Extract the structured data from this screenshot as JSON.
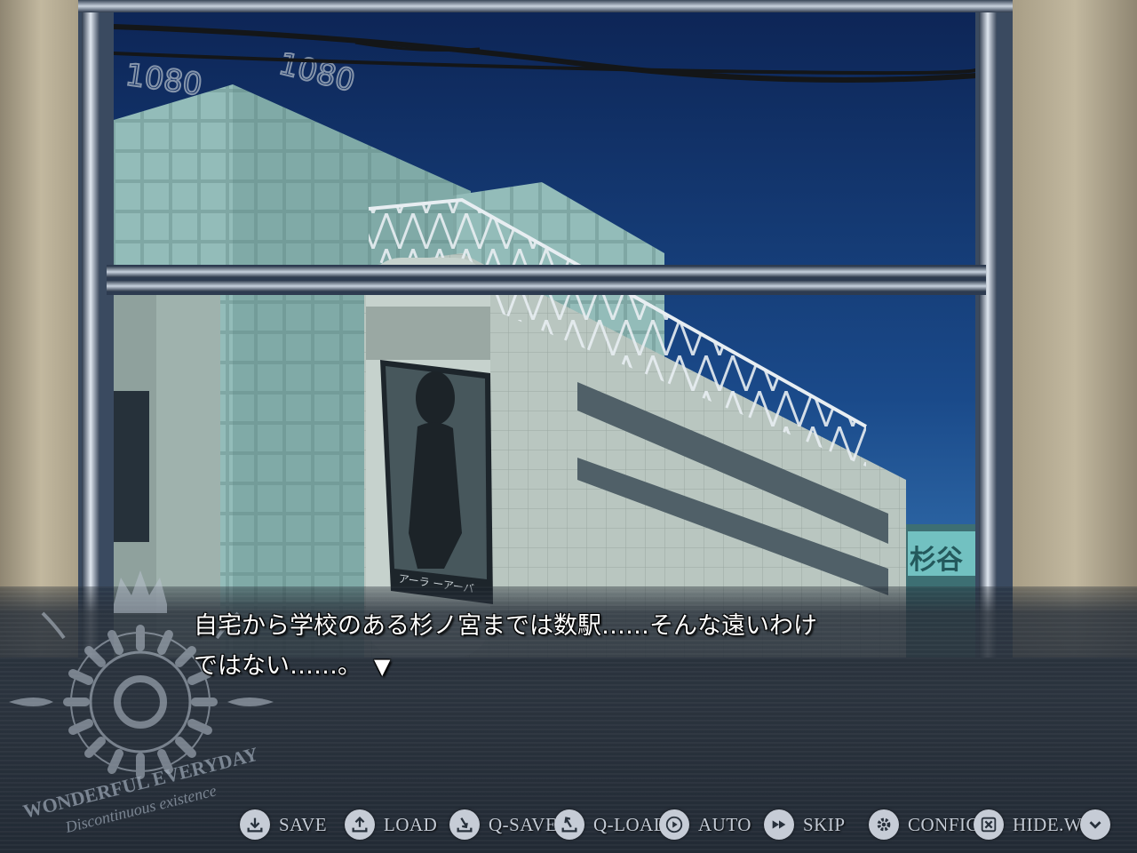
{
  "dialogue": {
    "lines": [
      "自宅から学校のある杉ノ宮までは数駅……そんな遠いわけ",
      "ではない……。"
    ],
    "next_marker": "▼"
  },
  "menu": [
    {
      "label": "SAVE",
      "icon": "save-icon"
    },
    {
      "label": "LOAD",
      "icon": "load-icon"
    },
    {
      "label": "Q-SAVE",
      "icon": "quick-save-icon"
    },
    {
      "label": "Q-LOAD",
      "icon": "quick-load-icon"
    },
    {
      "label": "AUTO",
      "icon": "play-icon"
    },
    {
      "label": "SKIP",
      "icon": "fast-forward-icon"
    },
    {
      "label": "CONFIG",
      "icon": "gear-icon"
    },
    {
      "label": "HIDE.W",
      "icon": "close-icon"
    },
    {
      "label": "",
      "icon": "chevron-down-icon"
    }
  ],
  "emblem": {
    "title": "WONDERFUL EVERYDAY",
    "subtitle": "Discontinuous existence"
  },
  "scene": {
    "building_sign": "1080 1080",
    "poster_text": "アーラ ーアーバ",
    "store_sign": "杉谷"
  },
  "colors": {
    "sky": "#0f2e63",
    "menu_text": "#c3cad4",
    "dialogue_text": "#ffffff",
    "window_frame": "#8b98ab"
  }
}
